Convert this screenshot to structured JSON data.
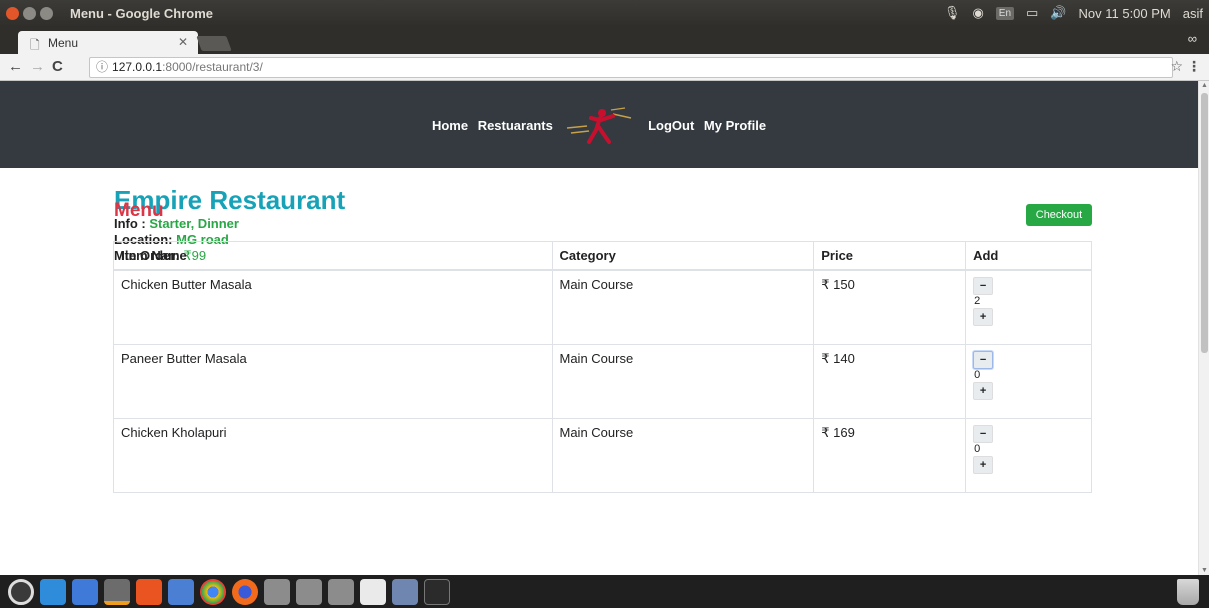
{
  "os": {
    "window_title": "Menu - Google Chrome",
    "tray": {
      "keyboard": "En",
      "datetime": "Nov 11  5:00 PM",
      "user": "asif"
    }
  },
  "browser": {
    "tab_label": "Menu",
    "url_host": "127.0.0.1",
    "url_path": ":8000/restaurant/3/"
  },
  "nav": {
    "home": "Home",
    "restaurants": "Restuarants",
    "logout": "LogOut",
    "profile": "My Profile"
  },
  "restaurant": {
    "name": "Empire Restaurant",
    "info_label": "Info : ",
    "info_value": "Starter, Dinner",
    "location_label": "Location: ",
    "location_value": "MG road",
    "min_order_label": "Min Order: ",
    "min_order_value": "₹99"
  },
  "menu": {
    "heading": "Menu",
    "checkout_label": "Checkout",
    "columns": [
      "Item Name",
      "Category",
      "Price",
      "Add"
    ],
    "items": [
      {
        "name": "Chicken Butter Masala",
        "category": "Main Course",
        "price": "₹ 150",
        "qty": "2"
      },
      {
        "name": "Paneer Butter Masala",
        "category": "Main Course",
        "price": "₹ 140",
        "qty": "0"
      },
      {
        "name": "Chicken Kholapuri",
        "category": "Main Course",
        "price": "₹ 169",
        "qty": "0"
      }
    ],
    "minus_symbol": "−",
    "plus_symbol": "+"
  },
  "colors": {
    "restaurant_name": "#17a2b8",
    "accent_green": "#28a745",
    "menu_heading": "#dc3545",
    "navbar_bg": "#343a40"
  },
  "dock_icons": [
    "dash-icon",
    "finder-icon",
    "files-icon",
    "sublime-icon",
    "ubuntu-software-icon",
    "folder-icon",
    "chrome-icon",
    "firefox-icon",
    "drive-icon",
    "drive-icon",
    "drive-icon",
    "text-editor-icon",
    "screenshot-icon",
    "terminal-icon",
    "trash-icon"
  ]
}
